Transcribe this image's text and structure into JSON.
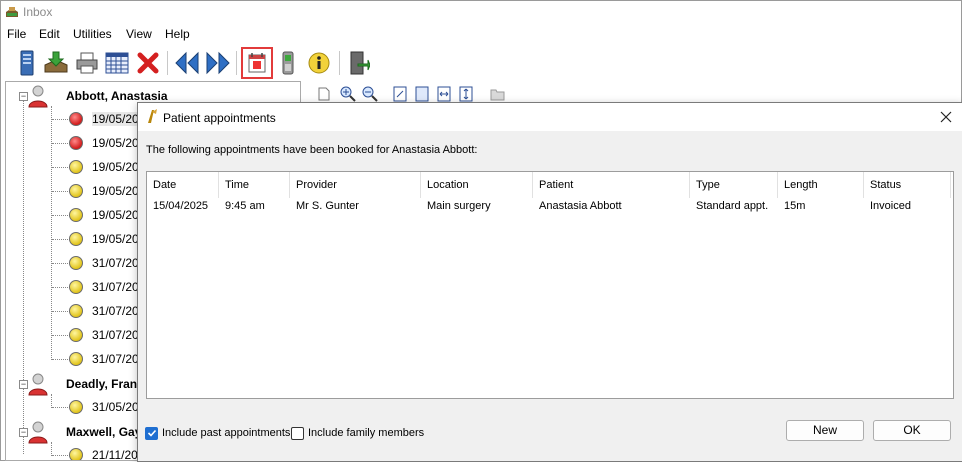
{
  "window": {
    "title": "Inbox"
  },
  "menu": [
    "File",
    "Edit",
    "Utilities",
    "View",
    "Help"
  ],
  "toolbar": {
    "icons": [
      "server-icon",
      "download-tray-icon",
      "printer-icon",
      "calendar-grid-icon",
      "delete-icon",
      "previous-icon",
      "next-icon",
      "appointments-icon",
      "phone-icon",
      "info-icon",
      "exit-icon"
    ],
    "highlight_color": "#e23b3b"
  },
  "tree": {
    "patients": [
      {
        "name": "Abbott, Anastasia",
        "appointments": [
          {
            "date": "19/05/20",
            "status": "red",
            "selected": true
          },
          {
            "date": "19/05/20",
            "status": "red"
          },
          {
            "date": "19/05/20",
            "status": "yellow"
          },
          {
            "date": "19/05/20",
            "status": "yellow"
          },
          {
            "date": "19/05/20",
            "status": "yellow"
          },
          {
            "date": "19/05/20",
            "status": "yellow"
          },
          {
            "date": "31/07/20",
            "status": "yellow"
          },
          {
            "date": "31/07/20",
            "status": "yellow"
          },
          {
            "date": "31/07/20",
            "status": "yellow"
          },
          {
            "date": "31/07/20",
            "status": "yellow"
          },
          {
            "date": "31/07/20",
            "status": "yellow"
          }
        ]
      },
      {
        "name": "Deadly, Fran",
        "appointments": [
          {
            "date": "31/05/20",
            "status": "yellow"
          }
        ]
      },
      {
        "name": "Maxwell, Gay",
        "appointments": [
          {
            "date": "21/11/20",
            "status": "yellow"
          }
        ]
      }
    ]
  },
  "dialog": {
    "title": "Patient appointments",
    "message": "The following appointments have been booked for Anastasia Abbott:",
    "columns": [
      "Date",
      "Time",
      "Provider",
      "Location",
      "Patient",
      "Type",
      "Length",
      "Status"
    ],
    "rows": [
      [
        "15/04/2025",
        "9:45 am",
        "Mr S. Gunter",
        "Main surgery",
        "Anastasia Abbott",
        "Standard appt.",
        "15m",
        "Invoiced"
      ]
    ],
    "include_past": {
      "label": "Include past appointments",
      "checked": true
    },
    "include_family": {
      "label": "Include family members",
      "checked": false
    },
    "new_label": "New",
    "ok_label": "OK",
    "accent_color": "#1f6fd1"
  }
}
